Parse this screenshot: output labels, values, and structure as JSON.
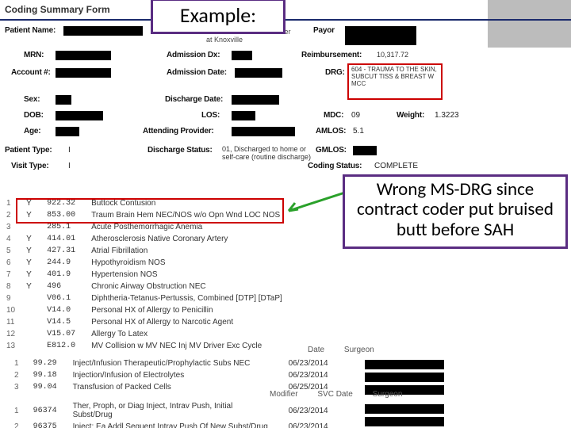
{
  "callouts": {
    "example": "Example:",
    "note": "Wrong MS-DRG since contract coder put bruised butt before SAH"
  },
  "form": {
    "title": "Coding Summary Form",
    "hospital": "Tennessee Medical Center at Knoxville",
    "labels": {
      "patient_name": "Patient Name:",
      "mrn": "MRN:",
      "account": "Account #:",
      "sex": "Sex:",
      "dob": "DOB:",
      "age": "Age:",
      "patient_type": "Patient Type:",
      "visit_type": "Visit Type:",
      "admission_dx": "Admission Dx:",
      "admission_date": "Admission Date:",
      "discharge_date": "Discharge Date:",
      "los": "LOS:",
      "attending": "Attending Provider:",
      "discharge_status": "Discharge Status:",
      "payor": "Payor",
      "reimbursement": "Reimbursement:",
      "drg": "DRG:",
      "mdc": "MDC:",
      "weight": "Weight:",
      "amlos": "AMLOS:",
      "gmlos": "GMLOS:",
      "coding_status": "Coding Status:"
    },
    "values": {
      "patient_type": "I",
      "visit_type": "I",
      "discharge_status": "01, Discharged to home or self-care (routine discharge)",
      "reimbursement": "10,317.72",
      "drg_text": "604 - TRAUMA TO THE SKIN, SUBCUT TISS & BREAST W MCC",
      "mdc": "09",
      "weight": "1.3223",
      "amlos": "5.1",
      "coding_status": "COMPLETE"
    }
  },
  "dx_rows": [
    {
      "n": "1",
      "poa": "Y",
      "code": "922.32",
      "desc": "Buttock Contusion"
    },
    {
      "n": "2",
      "poa": "Y",
      "code": "853.00",
      "desc": "Traum Brain Hem NEC/NOS w/o Opn Wnd LOC NOS"
    },
    {
      "n": "3",
      "poa": "",
      "code": "285.1",
      "desc": "Acute Posthemorrhagic Anemia"
    },
    {
      "n": "4",
      "poa": "Y",
      "code": "414.01",
      "desc": "Atherosclerosis Native Coronary Artery"
    },
    {
      "n": "5",
      "poa": "Y",
      "code": "427.31",
      "desc": "Atrial Fibrillation"
    },
    {
      "n": "6",
      "poa": "Y",
      "code": "244.9",
      "desc": "Hypothyroidism NOS"
    },
    {
      "n": "7",
      "poa": "Y",
      "code": "401.9",
      "desc": "Hypertension NOS"
    },
    {
      "n": "8",
      "poa": "Y",
      "code": "496",
      "desc": "Chronic Airway Obstruction NEC"
    },
    {
      "n": "9",
      "poa": "",
      "code": "V06.1",
      "desc": "Diphtheria-Tetanus-Pertussis, Combined [DTP] [DTaP]"
    },
    {
      "n": "10",
      "poa": "",
      "code": "V14.0",
      "desc": "Personal HX of Allergy to Penicillin"
    },
    {
      "n": "11",
      "poa": "",
      "code": "V14.5",
      "desc": "Personal HX of Allergy to Narcotic Agent"
    },
    {
      "n": "12",
      "poa": "",
      "code": "V15.07",
      "desc": "Allergy To Latex"
    },
    {
      "n": "13",
      "poa": "",
      "code": "E812.0",
      "desc": "MV Collision w MV NEC Inj MV Driver Exc Cycle"
    }
  ],
  "proc_header": {
    "c1": "Date",
    "c2": "Surgeon",
    "c3": "Modifier",
    "c4": "SVC Date"
  },
  "proc1": [
    {
      "n": "1",
      "code": "99.29",
      "desc": "Inject/Infusion Therapeutic/Prophylactic Subs NEC",
      "date": "06/23/2014"
    },
    {
      "n": "2",
      "code": "99.18",
      "desc": "Injection/Infusion of Electrolytes",
      "date": "06/23/2014"
    },
    {
      "n": "3",
      "code": "99.04",
      "desc": "Transfusion of Packed Cells",
      "date": "06/25/2014"
    }
  ],
  "proc2": [
    {
      "n": "1",
      "code": "96374",
      "desc": "Ther, Proph, or Diag Inject, Intrav Push, Initial Subst/Drug",
      "date": "06/23/2014"
    },
    {
      "n": "2",
      "code": "96375",
      "desc": "Inject; Ea Addl Sequent Intrav Push Of New Subst/Drug",
      "date": "06/23/2014"
    }
  ]
}
